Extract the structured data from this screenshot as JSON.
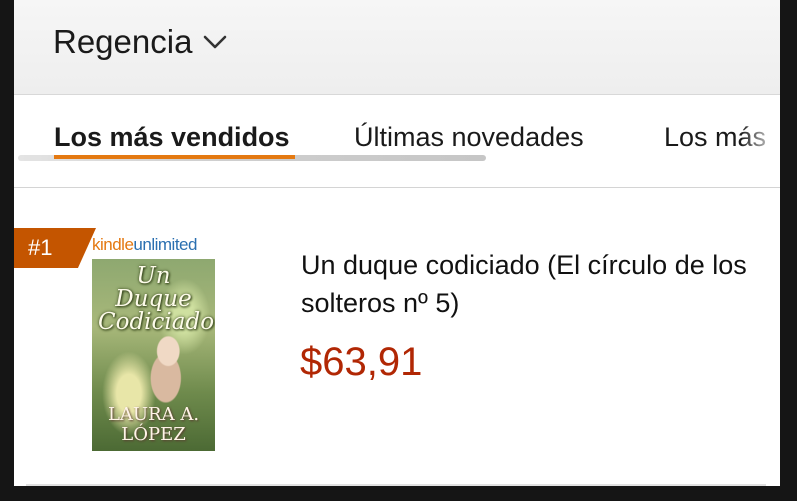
{
  "department": {
    "label": "Regencia",
    "icon": "chevron-down-icon"
  },
  "tabs": [
    {
      "label": "Los más vendidos",
      "active": true
    },
    {
      "label": "Últimas novedades",
      "active": false
    },
    {
      "label": "Los más",
      "active": false
    }
  ],
  "product": {
    "rank": "#1",
    "badge_kindle": "kindle",
    "badge_unlimited": "unlimited",
    "cover_title": "Un Duque Codiciado",
    "cover_author": "LAURA A. LÓPEZ",
    "title": "Un duque codiciado (El círculo de los solteros nº 5)",
    "price": "$63,91"
  },
  "colors": {
    "accent": "#e47911",
    "rank_badge": "#c45500",
    "price": "#b12704",
    "unlimited_blue": "#2a6fb0"
  }
}
